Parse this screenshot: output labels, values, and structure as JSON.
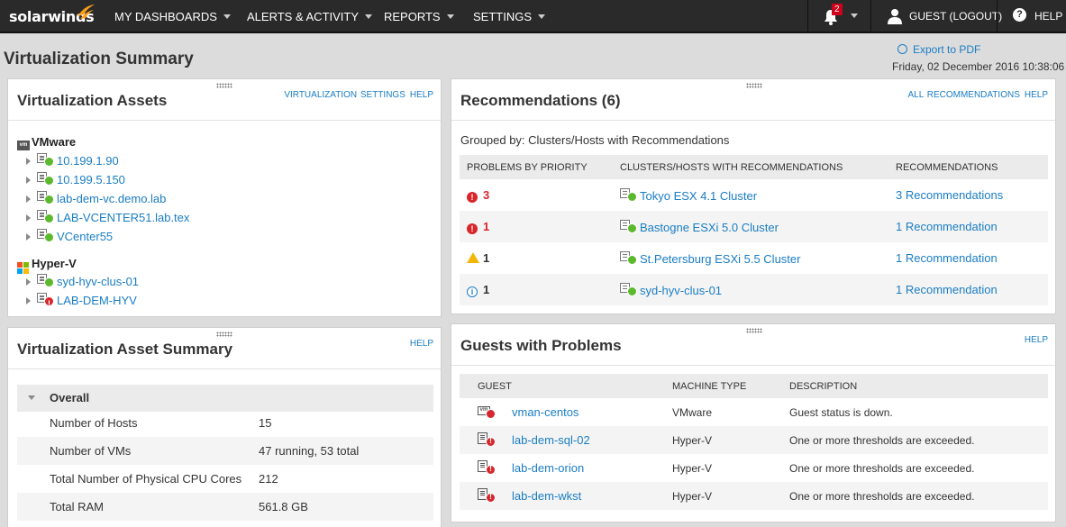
{
  "topbar": {
    "logo": "solarwinds",
    "nav": [
      "MY DASHBOARDS",
      "ALERTS & ACTIVITY",
      "REPORTS",
      "SETTINGS"
    ],
    "notification_count": "2",
    "user_label": "GUEST  (LOGOUT)",
    "help_label": "HELP",
    "icons": {
      "bell": "bell-icon",
      "user": "user-icon",
      "help": "help-icon"
    }
  },
  "page": {
    "title": "Virtualization Summary",
    "export_label": "Export to PDF",
    "datetime": "Friday, 02 December 2016 10:38:06"
  },
  "assets": {
    "title": "Virtualization Assets",
    "links": [
      "VIRTUALIZATION SETTINGS",
      "HELP"
    ],
    "vmware": {
      "label": "VMware",
      "items": [
        {
          "name": "10.199.1.90",
          "status": "up"
        },
        {
          "name": "10.199.5.150",
          "status": "up"
        },
        {
          "name": "lab-dem-vc.demo.lab",
          "status": "up"
        },
        {
          "name": "LAB-VCENTER51.lab.tex",
          "status": "up"
        },
        {
          "name": "VCenter55",
          "status": "up"
        }
      ]
    },
    "hyperv": {
      "label": "Hyper-V",
      "items": [
        {
          "name": "syd-hyv-clus-01",
          "status": "up"
        },
        {
          "name": "LAB-DEM-HYV",
          "status": "down"
        }
      ]
    }
  },
  "recommendations": {
    "title": "Recommendations (6)",
    "links": [
      "ALL RECOMMENDATIONS",
      "HELP"
    ],
    "grouped_by": "Grouped by: Clusters/Hosts with Recommendations",
    "headers": [
      "PROBLEMS BY PRIORITY",
      "CLUSTERS/HOSTS WITH RECOMMENDATIONS",
      "RECOMMENDATIONS"
    ],
    "rows": [
      {
        "severity": "critical",
        "count": "3",
        "cluster": "Tokyo ESX 4.1 Cluster",
        "recs": "3 Recommendations"
      },
      {
        "severity": "critical",
        "count": "1",
        "cluster": "Bastogne ESXi 5.0 Cluster",
        "recs": "1 Recommendation"
      },
      {
        "severity": "warning",
        "count": "1",
        "cluster": "St.Petersburg ESXi 5.5 Cluster",
        "recs": "1 Recommendation"
      },
      {
        "severity": "info",
        "count": "1",
        "cluster": "syd-hyv-clus-01",
        "recs": "1 Recommendation"
      }
    ]
  },
  "summary": {
    "title": "Virtualization Asset Summary",
    "links": [
      "HELP"
    ],
    "group": "Overall",
    "rows": [
      {
        "label": "Number of Hosts",
        "value": "15"
      },
      {
        "label": "Number of VMs",
        "value": "47 running, 53 total"
      },
      {
        "label": "Total Number of Physical CPU Cores",
        "value": "212"
      },
      {
        "label": "Total RAM",
        "value": "561.8 GB"
      }
    ]
  },
  "guests": {
    "title": "Guests with Problems",
    "links": [
      "HELP"
    ],
    "headers": [
      "GUEST",
      "MACHINE TYPE",
      "DESCRIPTION"
    ],
    "rows": [
      {
        "name": "vman-centos",
        "type": "VMware",
        "desc": "Guest status is down."
      },
      {
        "name": "lab-dem-sql-02",
        "type": "Hyper-V",
        "desc": "One or more thresholds are exceeded."
      },
      {
        "name": "lab-dem-orion",
        "type": "Hyper-V",
        "desc": "One or more thresholds are exceeded."
      },
      {
        "name": "lab-dem-wkst",
        "type": "Hyper-V",
        "desc": "One or more thresholds are exceeded."
      }
    ]
  },
  "colors": {
    "link": "#1a7dc4",
    "topbar": "#2a2a2a",
    "critical": "#d7262c",
    "ok": "#5cb82d",
    "warning": "#f2b705",
    "brand": "#f99d1c"
  }
}
